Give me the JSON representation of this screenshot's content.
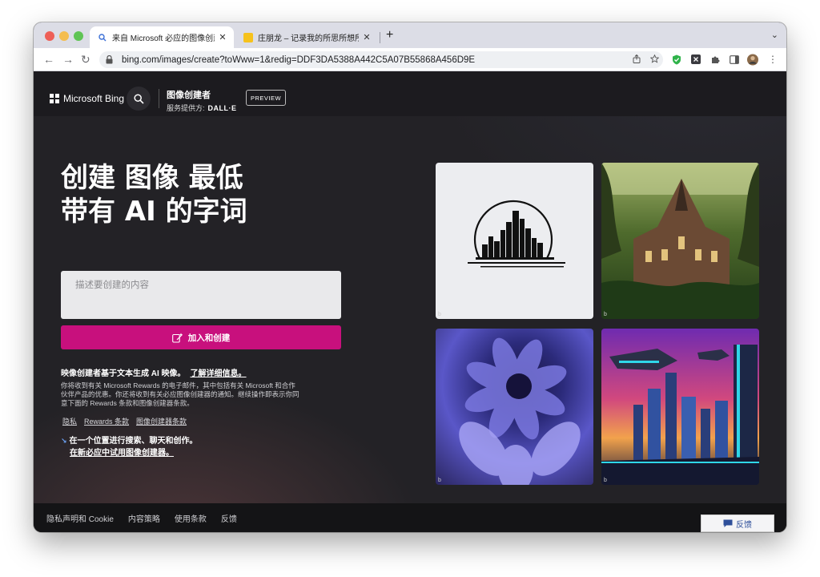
{
  "browser": {
    "tabs": [
      {
        "title": "来自 Microsoft 必应的图像创建者",
        "close": "✕"
      },
      {
        "title": "庄朋龙 – 记录我的所思所想所得",
        "close": "✕"
      }
    ],
    "new_tab": "+",
    "tab_menu": "⌄",
    "url": "bing.com/images/create?toWww=1&redig=DDF3DA5388A442C5A07B55868A456D9E",
    "nav": {
      "back": "←",
      "forward": "→",
      "reload": "↻"
    }
  },
  "header": {
    "logo_text": "Microsoft Bing",
    "product_name": "图像创建者",
    "powered_by_label": "服务提供方:",
    "powered_by_value": "DALL·E",
    "preview_label": "PREVIEW"
  },
  "hero": {
    "title_line1": "创建 图像 最低",
    "title_line2": "带有 AI 的字词"
  },
  "prompt": {
    "placeholder": "描述要创建的内容"
  },
  "create_button": {
    "label": "加入和创建"
  },
  "info": {
    "title": "映像创建者基于文本生成 AI 映像。",
    "learn_more": "了解详细信息。",
    "body": "你将收到有关 Microsoft Rewards 的电子邮件，其中包括有关 Microsoft 和合作伙伴产品的优惠。你还将收到有关必应图像创建器的通知。继续操作即表示你同意下面的 Rewards 条款和图像创建器条款。"
  },
  "legal_links": [
    "隐私",
    "Rewards 条款",
    "图像创建器条款"
  ],
  "promo": {
    "line1": "在一个位置进行搜索、聊天和创作。",
    "line2": "在新必应中试用图像创建器。"
  },
  "gallery": {
    "badge": "b"
  },
  "footer": {
    "links": [
      "隐私声明和 Cookie",
      "内容策略",
      "使用条款",
      "反馈"
    ],
    "feedback_button": "反馈"
  },
  "colors": {
    "accent": "#c8107d",
    "page_bg": "#232226",
    "header_bg": "#1c1b1f"
  }
}
